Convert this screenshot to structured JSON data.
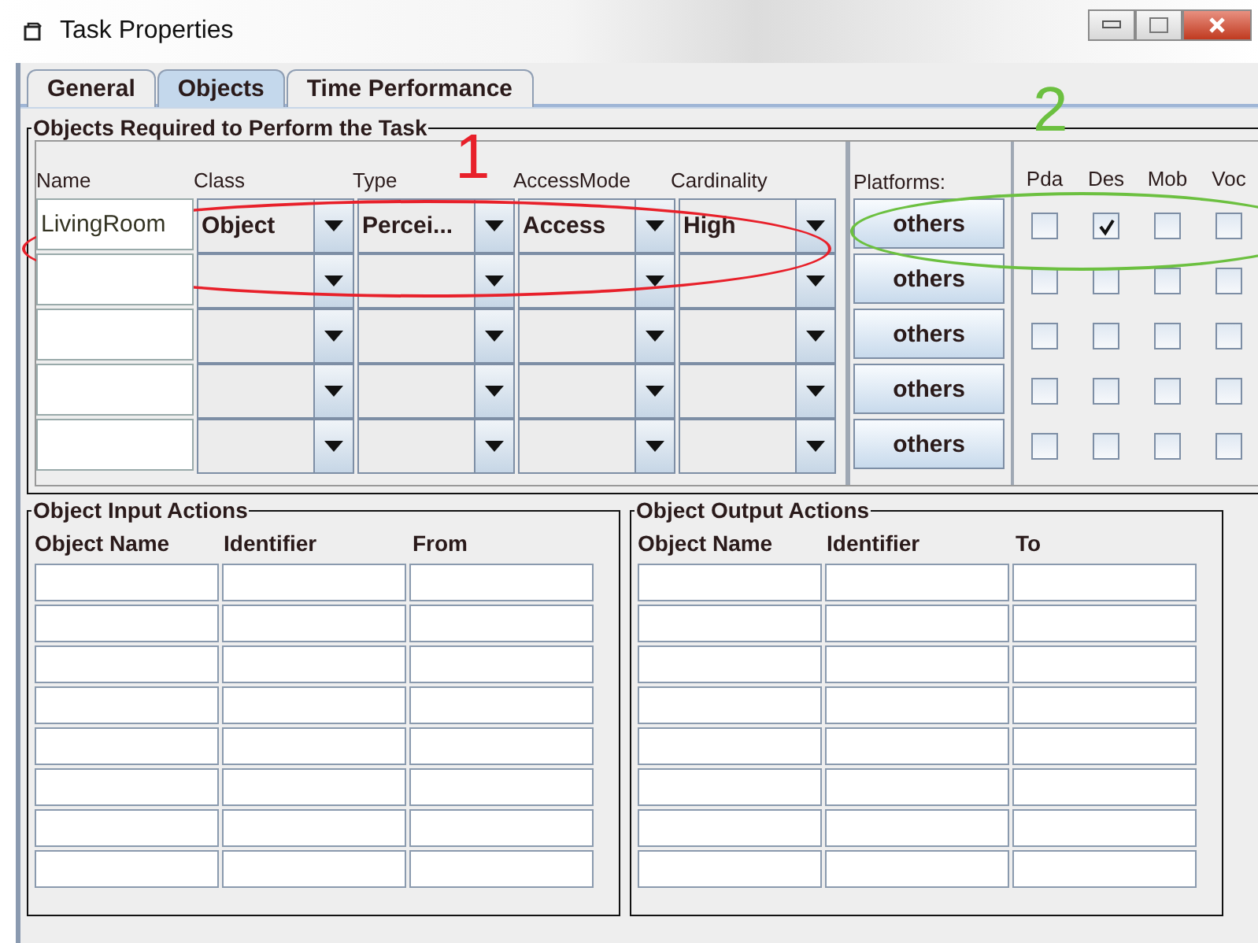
{
  "window": {
    "title": "Task Properties"
  },
  "tabs": [
    {
      "label": "General",
      "selected": false
    },
    {
      "label": "Objects",
      "selected": true
    },
    {
      "label": "Time Performance",
      "selected": false
    }
  ],
  "objects_group": {
    "title": "Objects Required to Perform the Task",
    "columns": [
      "Name",
      "Class",
      "Type",
      "AccessMode",
      "Cardinality"
    ],
    "platforms_label": "Platforms:",
    "platform_columns": [
      "Pda",
      "Des",
      "Mob",
      "Voc"
    ],
    "rows": [
      {
        "name": "LivingRoom",
        "class": "Object",
        "type": "Percei...",
        "access_mode": "Access",
        "cardinality": "High",
        "button": "others",
        "platforms": [
          {
            "checked": false
          },
          {
            "checked": true
          },
          {
            "checked": false
          },
          {
            "checked": false
          }
        ]
      },
      {
        "button": "others",
        "platforms": [
          {
            "checked": false
          },
          {
            "checked": false
          },
          {
            "checked": false
          },
          {
            "checked": false
          }
        ]
      },
      {
        "button": "others",
        "platforms": [
          {
            "checked": false
          },
          {
            "checked": false
          },
          {
            "checked": false
          },
          {
            "checked": false
          }
        ]
      },
      {
        "button": "others",
        "platforms": [
          {
            "checked": false
          },
          {
            "checked": false
          },
          {
            "checked": false
          },
          {
            "checked": false
          }
        ]
      },
      {
        "button": "others",
        "platforms": [
          {
            "checked": false
          },
          {
            "checked": false
          },
          {
            "checked": false
          },
          {
            "checked": false
          }
        ]
      }
    ]
  },
  "action_groups": [
    {
      "title": "Object Input Actions",
      "columns": [
        "Object Name",
        "Identifier",
        "From"
      ]
    },
    {
      "title": "Object Output Actions",
      "columns": [
        "Object Name",
        "Identifier",
        "To"
      ]
    }
  ],
  "annotations": [
    {
      "label": "1",
      "color": "#e8202a"
    },
    {
      "label": "2",
      "color": "#6cc040"
    }
  ]
}
